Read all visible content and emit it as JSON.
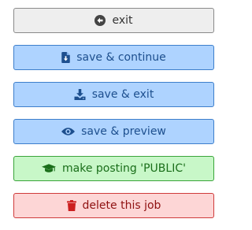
{
  "buttons": {
    "exit": {
      "label": "exit",
      "icon": "arrow-circle-left-icon"
    },
    "save_continue": {
      "label": "save & continue",
      "icon": "file-download-icon"
    },
    "save_exit": {
      "label": "save & exit",
      "icon": "download-icon"
    },
    "save_preview": {
      "label": "save & preview",
      "icon": "eye-icon"
    },
    "make_public": {
      "label": "make posting 'PUBLIC'",
      "icon": "graduation-cap-icon"
    },
    "delete_job": {
      "label": "delete this job",
      "icon": "trash-icon"
    }
  },
  "colors": {
    "default_bg": "#eeeeee",
    "blue_bg": "#aed3ff",
    "blue_icon": "#1d4f8e",
    "green_bg": "#c8f7c8",
    "green_icon": "#1a6e1a",
    "red_bg": "#fdd6d6",
    "red_icon": "#cc1f1f"
  }
}
